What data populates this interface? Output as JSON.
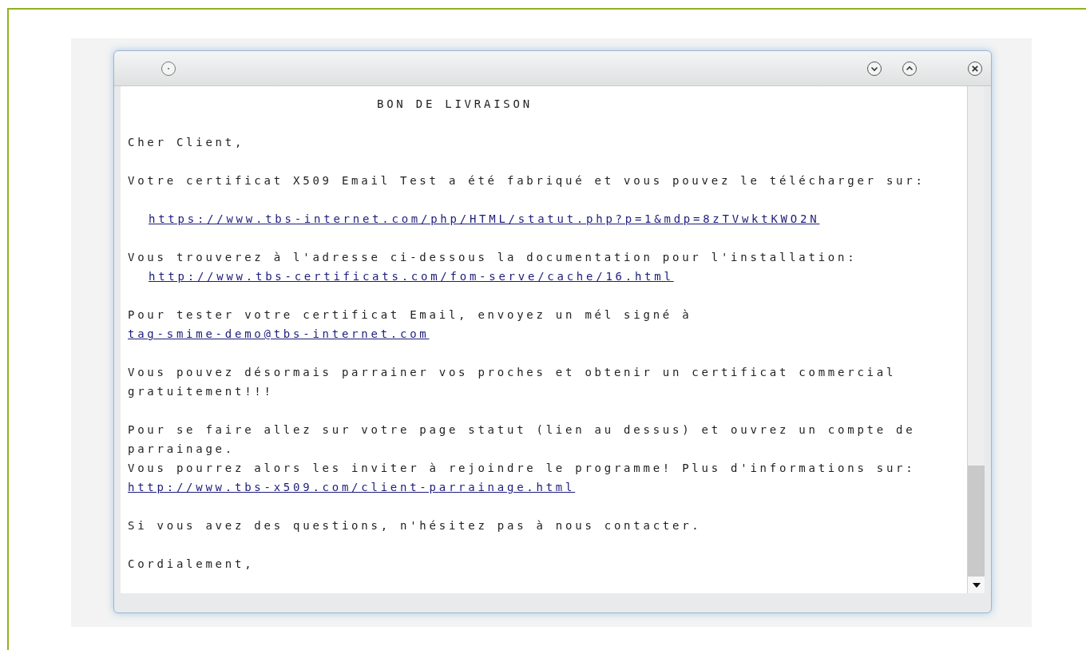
{
  "message": {
    "paragraphs": [
      {
        "lines": [
          {
            "kind": "heading",
            "text": "BON DE LIVRAISON"
          }
        ]
      },
      {
        "lines": [
          {
            "kind": "text",
            "text": "Cher Client,"
          }
        ]
      },
      {
        "lines": [
          {
            "kind": "text",
            "text": "Votre certificat X509 Email Test a été fabriqué et vous pouvez le télécharger sur:"
          }
        ]
      },
      {
        "lines": [
          {
            "kind": "indented-link",
            "text": "https://www.tbs-internet.com/php/HTML/statut.php?p=1&mdp=8zTVwktKWO2N"
          }
        ]
      },
      {
        "lines": [
          {
            "kind": "text",
            "text": "Vous trouverez à l'adresse ci-dessous la documentation pour l'installation:"
          },
          {
            "kind": "indented-link",
            "text": "http://www.tbs-certificats.com/fom-serve/cache/16.html"
          }
        ]
      },
      {
        "lines": [
          {
            "kind": "text",
            "text": "Pour tester votre certificat Email, envoyez un mél signé à"
          },
          {
            "kind": "link",
            "text": "tag-smime-demo@tbs-internet.com"
          }
        ]
      },
      {
        "lines": [
          {
            "kind": "text",
            "text": "Vous pouvez désormais parrainer vos proches et obtenir un certificat commercial"
          },
          {
            "kind": "text",
            "text": "gratuitement!!!"
          }
        ]
      },
      {
        "lines": [
          {
            "kind": "text",
            "text": "Pour se faire allez sur votre page statut (lien au dessus) et ouvrez un compte de"
          },
          {
            "kind": "text",
            "text": "parrainage."
          },
          {
            "kind": "text",
            "text": "Vous pourrez alors les inviter à rejoindre le programme! Plus d'informations sur:"
          },
          {
            "kind": "link",
            "text": "http://www.tbs-x509.com/client-parrainage.html"
          }
        ]
      },
      {
        "lines": [
          {
            "kind": "text",
            "text": "Si vous avez des questions, n'hésitez pas à nous contacter."
          }
        ]
      },
      {
        "lines": [
          {
            "kind": "text",
            "text": "Cordialement,"
          }
        ]
      }
    ]
  }
}
